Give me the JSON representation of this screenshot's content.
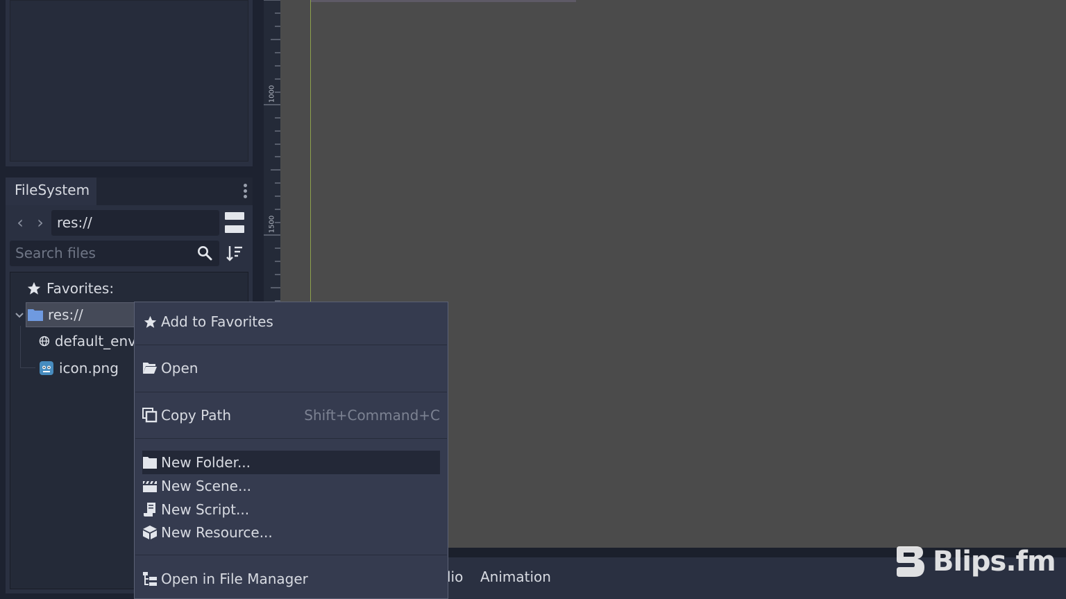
{
  "filesystem": {
    "tab_label": "FileSystem",
    "path_value": "res://",
    "search_placeholder": "Search files",
    "tree": {
      "favorites_label": "Favorites:",
      "root_label": "res://",
      "items": [
        {
          "label": "default_env",
          "icon": "globe-icon"
        },
        {
          "label": "icon.png",
          "icon": "godot-logo-icon"
        }
      ]
    }
  },
  "ruler": {
    "labels": [
      "1000",
      "1500"
    ]
  },
  "bottom_panel": {
    "tabs": [
      "lio",
      "Animation"
    ]
  },
  "context_menu": {
    "items": [
      {
        "label": "Add to Favorites",
        "icon": "star-icon"
      },
      {
        "label": "Open",
        "icon": "folder-open-icon"
      },
      {
        "label": "Copy Path",
        "icon": "copy-icon",
        "shortcut": "Shift+Command+C"
      },
      {
        "label": "New Folder...",
        "icon": "folder-icon"
      },
      {
        "label": "New Scene...",
        "icon": "clapperboard-icon"
      },
      {
        "label": "New Script...",
        "icon": "script-icon"
      },
      {
        "label": "New Resource...",
        "icon": "cube-icon"
      },
      {
        "label": "Open in File Manager",
        "icon": "filesystem-icon"
      }
    ]
  },
  "watermark": {
    "text": "Blips.fm"
  },
  "colors": {
    "editor_bg": "#2a3041",
    "viewport_bg": "#4b4b4b",
    "menu_bg": "#353b4f",
    "folder_blue": "#6f9ae0",
    "guide_green": "#8fa24c"
  }
}
